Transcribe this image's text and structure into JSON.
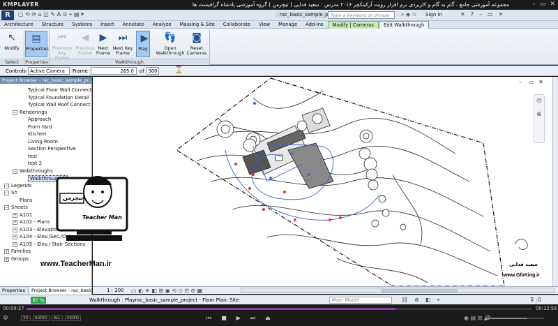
{
  "player": {
    "logo": "KMPLAYER",
    "video_title": "مجموعه آموزشی جامع ، گام به گام و کاربردی نرم افزار رویت آرکیتکچر ۲۰۱۶ مدرس : سعید فدایی ( تیچرمن ) گروه آموزشی پادشاه گرافیست ها",
    "time_current": "00:09:27",
    "time_total": "00:12:56",
    "seek_fraction": 0.73,
    "volume_fraction": 0.7,
    "badges": [
      "3D",
      "AUDIO",
      "ALL",
      "VIDEO"
    ],
    "controls": [
      "prev-icon",
      "stop-icon",
      "play-icon",
      "next-icon",
      "eject-icon"
    ]
  },
  "revit": {
    "doc_title": "rac_basic_sample_project - Floor Plan: Site",
    "search_placeholder": "Type a keyword or phrase",
    "sign_in": "Sign In",
    "tabs": [
      "Architecture",
      "Structure",
      "Systems",
      "Insert",
      "Annotate",
      "Analyze",
      "Massing & Site",
      "Collaborate",
      "View",
      "Manage",
      "Add-Ins",
      "Modify | Cameras",
      "Edit Walkthrough"
    ],
    "ribbon": {
      "select_buttons": [
        {
          "label": "Modify",
          "icon": "modify-icon"
        }
      ],
      "select_panel": "Select",
      "properties_buttons": [
        {
          "label": "Properties",
          "icon": "properties-icon"
        }
      ],
      "properties_panel": "Properties",
      "walkthrough_buttons": [
        {
          "label": "Previous Key Frame",
          "icon": "previous-key-frame-icon",
          "enabled": false
        },
        {
          "label": "Previous Frame",
          "icon": "previous-frame-icon",
          "enabled": false
        },
        {
          "label": "Next Frame",
          "icon": "next-frame-icon",
          "enabled": true
        },
        {
          "label": "Next Key Frame",
          "icon": "next-key-frame-icon",
          "enabled": true
        },
        {
          "label": "Play",
          "icon": "play-icon",
          "enabled": true
        },
        {
          "label": "Open Walkthrough",
          "icon": "open-walkthrough-icon",
          "enabled": true
        },
        {
          "label": "Reset Cameras",
          "icon": "reset-cameras-icon",
          "enabled": true
        }
      ],
      "walkthrough_panel": "Walkthrough"
    },
    "options": {
      "controls_label": "Controls",
      "controls_value": "Active Camera",
      "frame_label": "Frame",
      "frame_value": "265.0",
      "of_label": "of",
      "total_frames": "300"
    },
    "browser": {
      "header": "Project Browser - rac_basic_sample_pr...",
      "items": [
        {
          "label": "Typical Floor Wall Connect",
          "level": 3
        },
        {
          "label": "Typical Foundation Detail",
          "level": 3
        },
        {
          "label": "Typical Wall Roof Connect",
          "level": 3
        },
        {
          "label": "Renderings",
          "level": 2,
          "expander": "−"
        },
        {
          "label": "Approach",
          "level": 3
        },
        {
          "label": "From Yard",
          "level": 3
        },
        {
          "label": "Kitchen",
          "level": 3
        },
        {
          "label": "Living Room",
          "level": 3
        },
        {
          "label": "Section Perspective",
          "level": 3
        },
        {
          "label": "test",
          "level": 3
        },
        {
          "label": "test 2",
          "level": 3
        },
        {
          "label": "Walkthroughs",
          "level": 2,
          "expander": "−"
        },
        {
          "label": "Walkthrough 1",
          "level": 3,
          "selected": true
        },
        {
          "label": "Legends",
          "level": 1,
          "expander": "−"
        },
        {
          "label": "Sh",
          "level": 1,
          "expander": "−"
        },
        {
          "label": "Plans",
          "level": 2
        },
        {
          "label": "Sheets",
          "level": 1,
          "expander": "−"
        },
        {
          "label": "A101",
          "level": 2,
          "expander": "+"
        },
        {
          "label": "A102 - Plans",
          "level": 2,
          "expander": "+"
        },
        {
          "label": "A103 - Elevations/Sections",
          "level": 2,
          "expander": "+"
        },
        {
          "label": "A104 - Elev./Sec./Det.",
          "level": 2,
          "expander": "+"
        },
        {
          "label": "A105 - Elev./ Stair Sections",
          "level": 2,
          "expander": "+"
        },
        {
          "label": "Families",
          "level": 1,
          "expander": "+"
        },
        {
          "label": "Groups",
          "level": 1,
          "expander": "+"
        }
      ],
      "tabs": [
        "Properties",
        "Project Browser - rac_basic_..."
      ]
    },
    "view_scale": "1 : 200",
    "status": {
      "counter": "87 %",
      "text": "Walkthrough : Playrac_basic_sample_project - Floor Plan: Site",
      "model": "Main Model"
    }
  },
  "watermark": {
    "website": "www.TeacherMan.ir",
    "logo_text_fa": "تیچرمن",
    "logo_text_en": "Teacher Man",
    "gfx_name": "سعید فدایی",
    "gfx_site": "www.GfxKing.ir"
  }
}
